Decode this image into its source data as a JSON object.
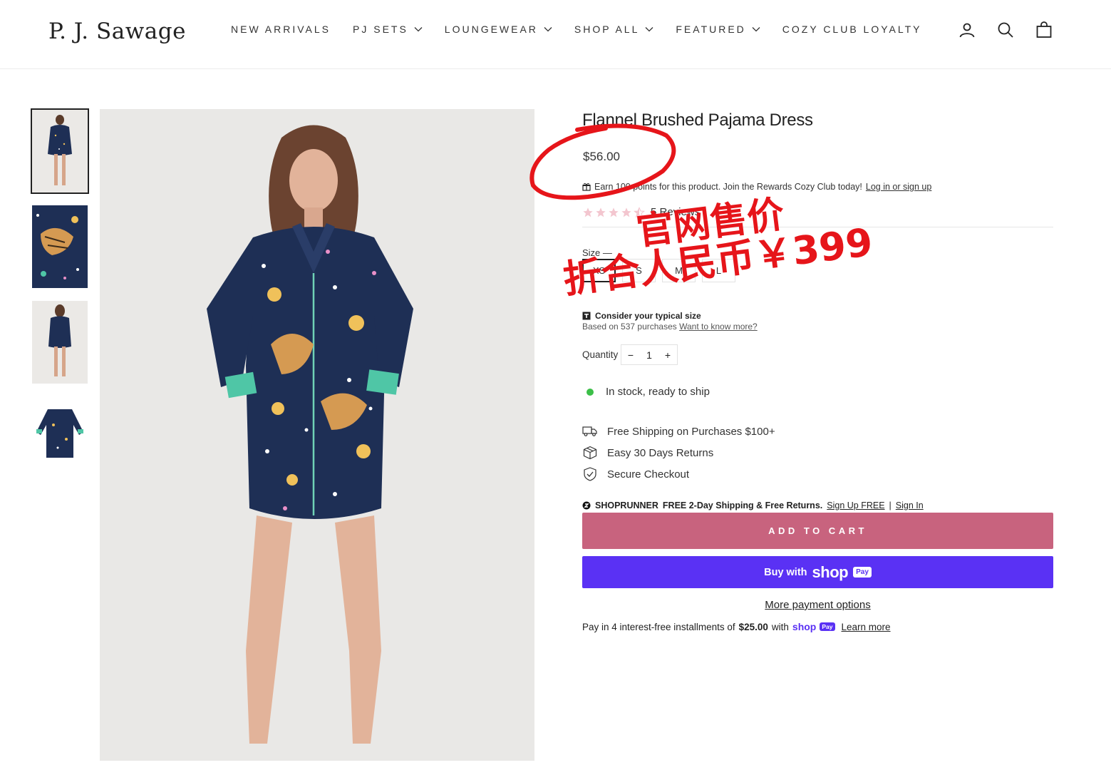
{
  "header": {
    "logo": "P. J. Sawage",
    "nav": [
      {
        "label": "NEW ARRIVALS",
        "has_dropdown": false
      },
      {
        "label": "PJ SETS",
        "has_dropdown": true
      },
      {
        "label": "LOUNGEWEAR",
        "has_dropdown": true
      },
      {
        "label": "SHOP ALL",
        "has_dropdown": true
      },
      {
        "label": "FEATURED",
        "has_dropdown": true
      },
      {
        "label": "COZY CLUB LOYALTY",
        "has_dropdown": false
      }
    ],
    "icons": [
      "account-icon",
      "search-icon",
      "cart-icon"
    ]
  },
  "gallery": {
    "thumbnails": [
      "front view",
      "print detail",
      "back view",
      "flat lay"
    ],
    "active_index": 0
  },
  "product": {
    "title": "Flannel Brushed Pajama Dress",
    "price": "$56.00",
    "rewards": {
      "text": "Earn 100 points for this product. Join the Rewards Cozy Club today!",
      "link": "Log in or sign up"
    },
    "rating": 4.5,
    "reviews_label": "5 Reviews",
    "size_label": "Size —",
    "sizes": [
      "XS",
      "S",
      "M",
      "L"
    ],
    "selected_size": "XS",
    "fit": {
      "title": "Consider your typical size",
      "sub": "Based on 537 purchases",
      "link": "Want to know more?"
    },
    "quantity_label": "Quantity",
    "quantity": "1",
    "qty_minus": "−",
    "qty_plus": "+",
    "stock": "In stock, ready to ship",
    "features": [
      {
        "icon": "truck-icon",
        "label": "Free Shipping on Purchases $100+"
      },
      {
        "icon": "box-icon",
        "label": "Easy 30 Days Returns"
      },
      {
        "icon": "shield-icon",
        "label": "Secure Checkout"
      }
    ],
    "shoprunner": {
      "brand": "SHOPRUNNER",
      "offer": "FREE 2-Day Shipping & Free Returns.",
      "signup": "Sign Up FREE",
      "sep": "|",
      "signin": "Sign In"
    },
    "add_to_cart": "ADD TO CART",
    "shop_pay": {
      "buy_with": "Buy with",
      "shop": "shop",
      "pay": "Pay"
    },
    "more_payment": "More payment options",
    "installments": {
      "text": "Pay in 4 interest-free installments of",
      "amount": "$25.00",
      "with": "with",
      "shop": "shop",
      "pay": "Pay",
      "learn": "Learn more"
    }
  },
  "annotation": {
    "line1": "官网售价",
    "line2": "折合人民币￥399",
    "color": "#e6151a"
  },
  "colors": {
    "add_to_cart": "#c8637e",
    "shop_pay": "#5a31f4",
    "in_stock": "#3cbf48",
    "garment": "#1e2f55",
    "cuff": "#4fc6a6"
  }
}
